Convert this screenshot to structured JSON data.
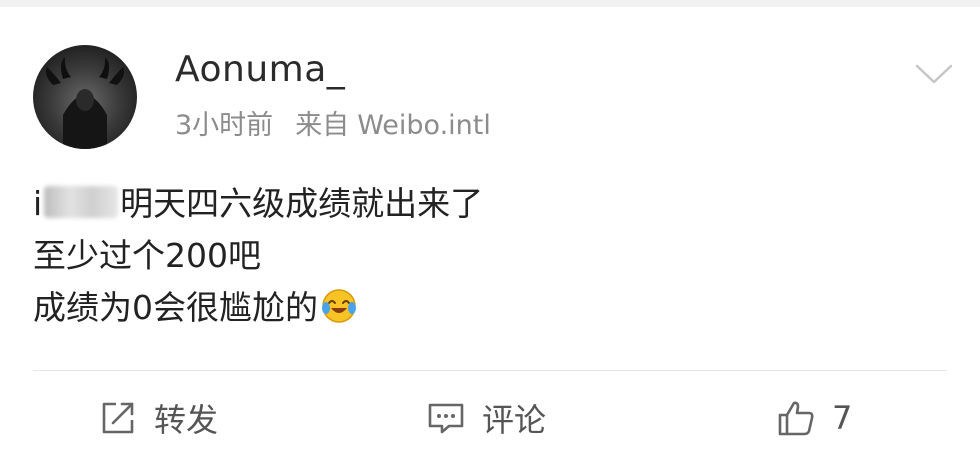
{
  "post": {
    "author": {
      "name": "Aonuma_"
    },
    "meta": {
      "time": "3小时前",
      "source_prefix": "来自",
      "source": "Weibo.intl"
    },
    "content": {
      "line1_prefix": "i",
      "line1_suffix": "明天四六级成绩就出来了",
      "line2": "至少过个200吧",
      "line3": "成绩为0会很尴尬的"
    },
    "icons": {
      "menu": "chevron-down-icon",
      "emoji": "laughing-tears-emoji",
      "repost": "share-edit-icon",
      "comment": "comment-bubble-icon",
      "like": "thumbs-up-icon"
    },
    "actions": {
      "repost_label": "转发",
      "comment_label": "评论",
      "like_count": "7"
    }
  }
}
